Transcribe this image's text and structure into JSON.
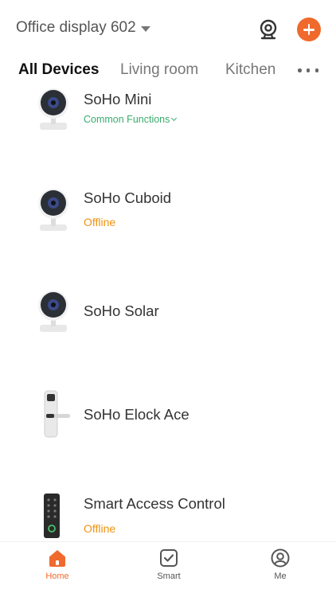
{
  "header": {
    "home_title": "Office display 602"
  },
  "tabs": [
    {
      "label": "All Devices",
      "active": true
    },
    {
      "label": "Living room",
      "active": false
    },
    {
      "label": "Kitchen",
      "active": false
    }
  ],
  "devices": [
    {
      "name": "SoHo Mini",
      "subtitle": "Common Functions",
      "subtitle_kind": "functions",
      "icon": "camera-round"
    },
    {
      "name": "SoHo Cuboid",
      "subtitle": "Offline",
      "subtitle_kind": "status",
      "icon": "camera-round"
    },
    {
      "name": "SoHo Solar",
      "subtitle": "",
      "subtitle_kind": "",
      "icon": "camera-round"
    },
    {
      "name": "SoHo Elock Ace",
      "subtitle": "",
      "subtitle_kind": "",
      "icon": "door-lock"
    },
    {
      "name": "Smart Access Control",
      "subtitle": "Offline",
      "subtitle_kind": "status",
      "icon": "keypad"
    }
  ],
  "bottom_nav": {
    "home": "Home",
    "smart": "Smart",
    "me": "Me"
  },
  "colors": {
    "accent": "#ef6a2c",
    "offline": "#f0920e",
    "functions": "#3aab6e"
  }
}
